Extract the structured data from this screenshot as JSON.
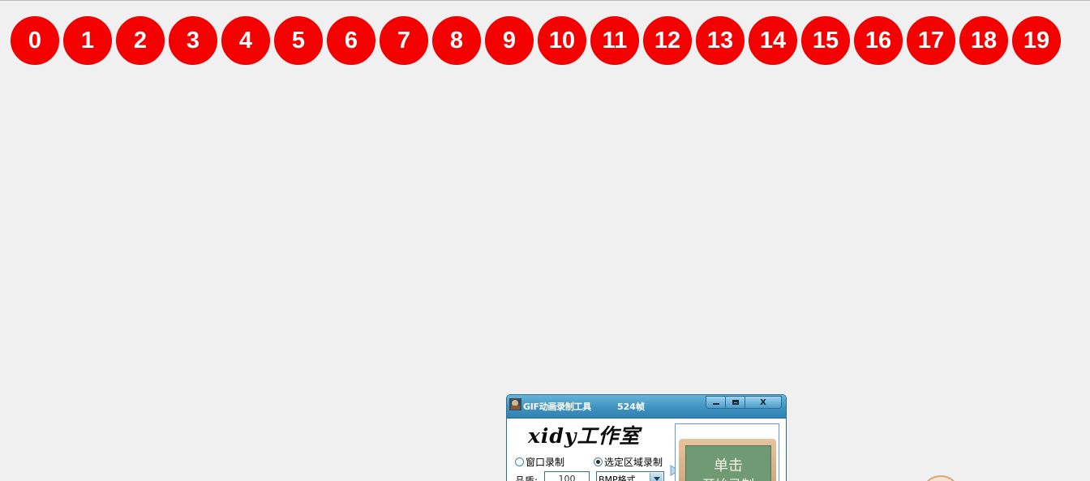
{
  "circles": [
    "0",
    "1",
    "2",
    "3",
    "4",
    "5",
    "6",
    "7",
    "8",
    "9",
    "10",
    "11",
    "12",
    "13",
    "14",
    "15",
    "16",
    "17",
    "18",
    "19"
  ],
  "recorder": {
    "title": "GIF动画录制工具",
    "frames": "524帧",
    "close_label": "X",
    "logo": "xidy工作室",
    "radio_window": "窗口录制",
    "radio_area": "选定区域录制",
    "quality_label": "品质:",
    "quality_value": "100",
    "format_value": "BMP格式",
    "record_text": "单击",
    "record_text2": "开始录制"
  },
  "colors": {
    "circle_fill": "#f50000",
    "background": "#f0f0f0",
    "titlebar": "#3f93c0"
  }
}
